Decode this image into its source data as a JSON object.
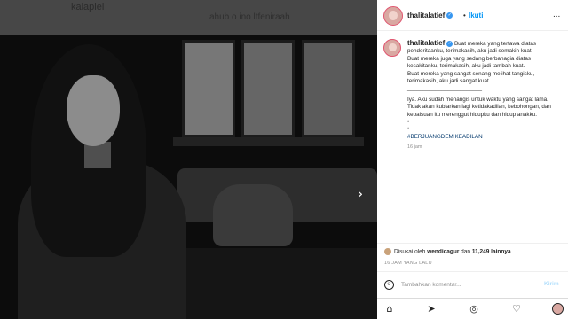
{
  "background": {
    "title": "kalaplei",
    "subtitle": "ahub o ino ltfeniraah"
  },
  "post": {
    "username": "thalitalatief",
    "follow_label": "Ikuti",
    "more_label": "...",
    "caption_lines": [
      "Buat mereka yang tertawa diatas penderitaanku, terimakasih, aku jadi semakin kuat.",
      "Buat mereka juga yang sedang berbahagia diatas kesakitanku, terimakasih, aku jadi tambah kuat.",
      "Buat mereka yang sangat senang melihat tangisku, terimakasih, aku jadi sangat kuat.",
      "________________________",
      "Iya. Aku sudah menangis untuk waktu yang sangat lama.",
      "Tidak akan kubiarkan lagi ketidakadilan, kebohongan, dan kepalsuan itu merenggut hidupku dan hidup anakku.",
      "•",
      "•"
    ],
    "hashtag": "#BERJUANGDEMIKEADILAN",
    "caption_time": "16 jam",
    "liked_by_prefix": "Disukai oleh",
    "liked_by_user": "wendicagur",
    "liked_by_and": "dan",
    "liked_by_count": "11,249 lainnya",
    "posted_ago": "16 JAM YANG LALU",
    "comment_placeholder": "Tambahkan komentar...",
    "post_button": "Kirim",
    "next_arrow": "›"
  },
  "nav": {
    "icons": [
      "home-icon",
      "send-icon",
      "explore-icon",
      "heart-icon",
      "profile-avatar"
    ]
  },
  "colors": {
    "accent": "#0095f6",
    "hashtag": "#00376b",
    "verified": "#3897f0"
  }
}
